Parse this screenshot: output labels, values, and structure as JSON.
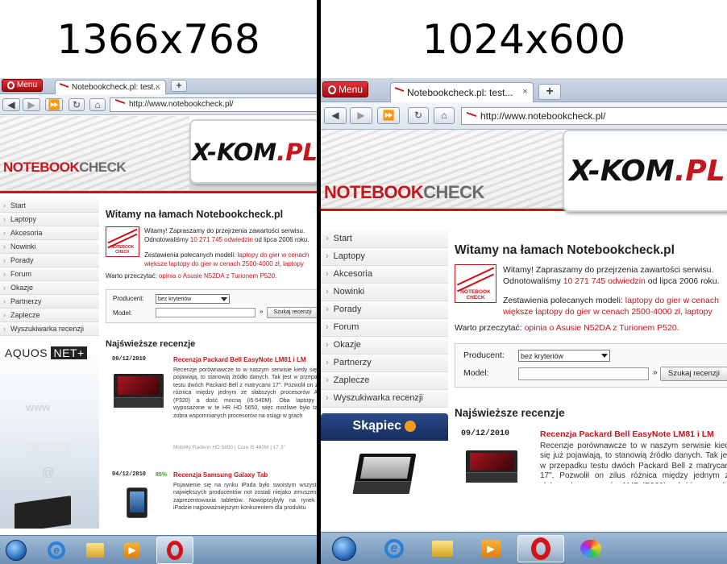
{
  "left": {
    "heading": "1366x768",
    "menu_label": "Menu",
    "tab_title": "Notebookcheck.pl: test...",
    "tab_close": "×",
    "newtab": "+",
    "url": "http://www.notebookcheck.pl/",
    "logo_a": "NOTEBOOK",
    "logo_b": "CHECK",
    "ad_a": "X-KOM",
    "ad_b": ".PL",
    "side_ad": "AQUOS",
    "side_ad_b": "NET+",
    "side_ad_www": "www",
    "side_ad_at": "@"
  },
  "right": {
    "heading": "1024x600",
    "menu_label": "Menu",
    "tab_title": "Notebookcheck.pl: test...",
    "tab_close": "×",
    "newtab": "+",
    "url": "http://www.notebookcheck.pl/",
    "logo_a": "NOTEBOOK",
    "logo_b": "CHECK",
    "ad_a": "X-KOM",
    "ad_b": ".PL",
    "side_ad": "Skąpiec"
  },
  "site": {
    "sidebar_items": [
      "Start",
      "Laptopy",
      "Akcesoria",
      "Nowinki",
      "Porady",
      "Forum",
      "Okazje",
      "Partnerzy",
      "Zaplecze",
      "Wyszukiwarka recenzji"
    ],
    "welcome_title": "Witamy na łamach Notebookcheck.pl",
    "welcome_text_a": "Witamy! Zapraszamy do przejrzenia zawartości serwisu.",
    "visits_a": "Odnotowaliśmy",
    "visits_count": "10 271 745 odwiedzin",
    "visits_b": "od lipca 2006 roku.",
    "recommend_a": "Zestawienia polecanych modeli:",
    "recommend_link1": "laptopy do gier w cenach",
    "recommend_link2": "większe laptopy do gier w cenach 2500-4000 zł, laptopy",
    "worth_a": "Warto przeczytać:",
    "worth_link": "opinia o Asusie N52DA z Turionem P520",
    "worth_end": ".",
    "logo_small": "NOTEBOOK CHECK",
    "form_producer_label": "Producent:",
    "form_producer_value": "bez kryteriów",
    "form_model_label": "Model:",
    "form_search_button": "Szukaj recenzji",
    "form_arrow": "»",
    "reviews_title": "Najświeższe recenzje",
    "review1": {
      "date": "09/12/2010",
      "title": "Recenzja Packard Bell EasyNote LM81 i LM",
      "text": "Recenzje porównawcze to w naszym serwisie kiedy się już pojawiają, to stanowią źródło danych. Tak jest w przepadku testu dwóch Packard Bell z matrycami 17\". Pozwolił on zilus różnica między jednym ze słabszych procesorów AMD (P320) a dość mocną (i5-540M). Oba laptopy są wyposażone w te HR HD 5650, więc możliwe było także zobra wspomnianych procesorów na osiągi w grach",
      "spec": "Mobility Radeon HD 5650 | Core i5 460M | 17.3\""
    },
    "review2": {
      "date": "04/12/2010",
      "score": "85%",
      "title": "Recenzja Samsung Galaxy Tab",
      "text": "Pojawienie się na rynku iPada było swoistym wszystkich największych producentów not zostali niejako zmuszeni do zaprezentowania tabletów. Nowoprzybyły na rynek po iPadzie najpoważniejszym konkurentem dla produktu"
    }
  },
  "taskbar": {
    "apps": [
      "start-orb",
      "internet-explorer",
      "explorer-folder",
      "media-player",
      "opera",
      "paint"
    ]
  }
}
